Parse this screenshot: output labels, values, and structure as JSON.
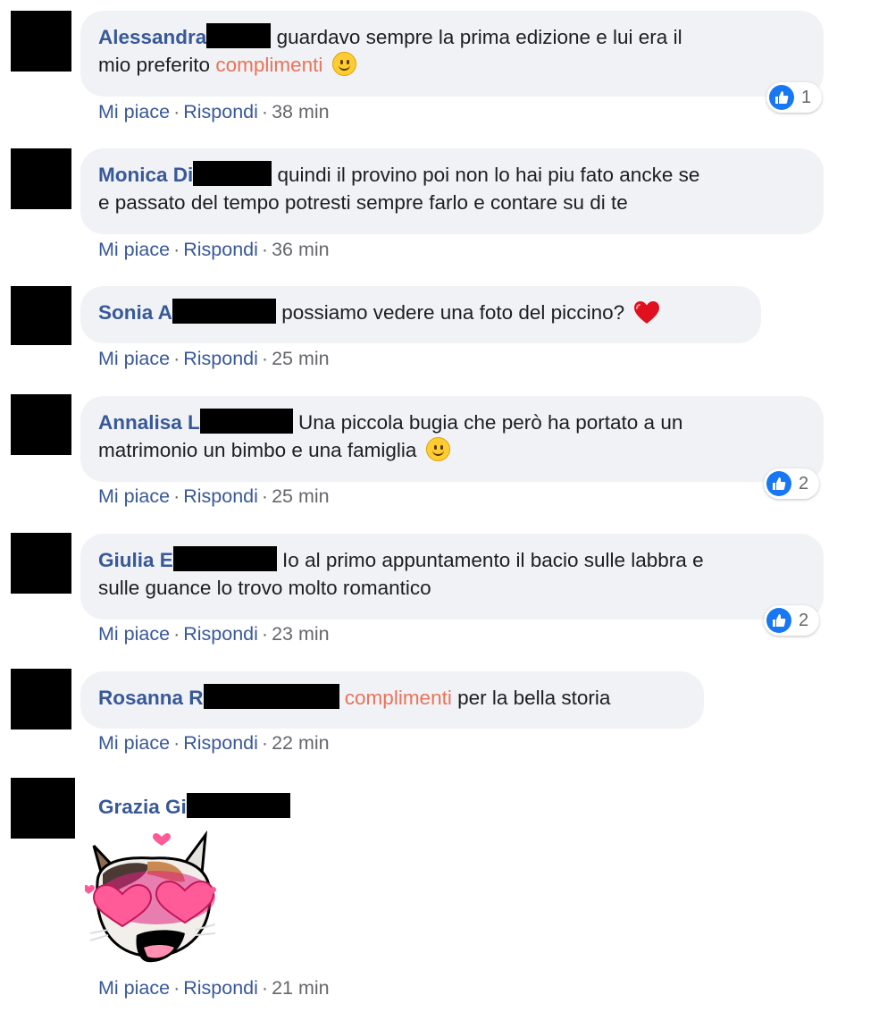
{
  "actions": {
    "like": "Mi piace",
    "reply": "Rispondi",
    "separator": "·"
  },
  "comments": [
    {
      "author": "Alessandra",
      "text_before": "guardavo sempre la prima edizione e lui era il",
      "line2_prefix": "mio preferito ",
      "mention": "complimenti",
      "emoji": "slightly-smiling-face",
      "time": "38 min",
      "reactions": "1"
    },
    {
      "author": "Monica Di",
      "line1": "quindi il provino poi non lo hai piu fato ancke se",
      "line2": "e passato del tempo potresti sempre farlo e contare su di te",
      "time": "36 min"
    },
    {
      "author": "Sonia A",
      "line1": "possiamo vedere una foto del piccino?",
      "emoji": "red-heart",
      "time": "25 min"
    },
    {
      "author": "Annalisa L",
      "line1": "Una piccola bugia che però ha portato a un",
      "line2": "matrimonio un bimbo e una famiglia",
      "emoji": "slightly-smiling-face",
      "time": "25 min",
      "reactions": "2"
    },
    {
      "author": "Giulia E",
      "line1": "Io al primo appuntamento il bacio sulle labbra e",
      "line2": "sulle guance lo trovo molto romantico",
      "time": "23 min",
      "reactions": "2"
    },
    {
      "author": "Rosanna R",
      "mention": "complimenti",
      "line1": " per la bella storia",
      "time": "22 min"
    },
    {
      "author": "Grazia Gi",
      "sticker": "heart-eyes-cat-sticker",
      "time": "21 min"
    }
  ],
  "colors": {
    "author": "#385898",
    "mention": "#e9735a",
    "bubble": "#f0f2f5",
    "like_blue": "#1877f2"
  }
}
